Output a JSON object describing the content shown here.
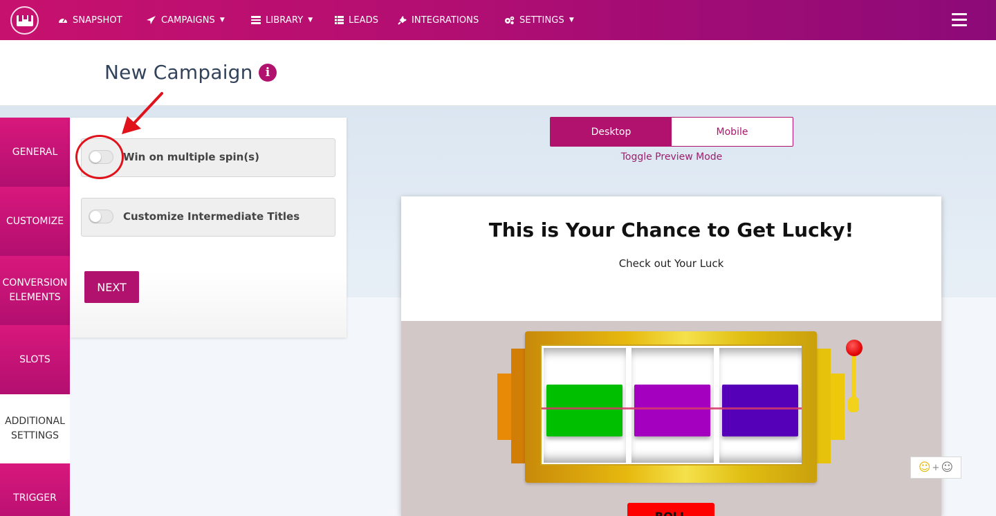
{
  "nav": {
    "items": [
      {
        "label": "SNAPSHOT",
        "icon": "dashboard-icon",
        "caret": false
      },
      {
        "label": "CAMPAIGNS",
        "icon": "paper-plane-icon",
        "caret": true
      },
      {
        "label": "LIBRARY",
        "icon": "library-icon",
        "caret": true
      },
      {
        "label": "LEADS",
        "icon": "list-icon",
        "caret": false
      },
      {
        "label": "INTEGRATIONS",
        "icon": "plug-icon",
        "caret": false
      },
      {
        "label": "SETTINGS",
        "icon": "cogs-icon",
        "caret": true
      }
    ],
    "caret_glyph": "▼",
    "colors": {
      "gradient_start": "#c7116e",
      "gradient_end": "#8c0a78"
    }
  },
  "header": {
    "title": "New Campaign",
    "info_glyph": "i"
  },
  "sidebar": {
    "tabs": [
      {
        "label": "GENERAL",
        "active": false
      },
      {
        "label": "CUSTOMIZE",
        "active": false
      },
      {
        "label": "CONVERSION ELEMENTS",
        "active": false
      },
      {
        "label": "SLOTS",
        "active": false
      },
      {
        "label": "ADDITIONAL SETTINGS",
        "active": true
      },
      {
        "label": "TRIGGER",
        "active": false
      }
    ]
  },
  "form": {
    "options": [
      {
        "label": "Win on multiple spin(s)",
        "enabled": false
      },
      {
        "label": "Customize Intermediate Titles",
        "enabled": false
      }
    ],
    "next_label": "NEXT"
  },
  "preview_mode": {
    "options": [
      "Desktop",
      "Mobile"
    ],
    "selected": "Desktop",
    "caption": "Toggle Preview Mode"
  },
  "preview": {
    "title": "This is Your Chance to Get Lucky!",
    "subtitle": "Check out Your Luck",
    "reels": [
      {
        "color": "#00bf00"
      },
      {
        "color": "#a300c0"
      },
      {
        "color": "#5500b8"
      }
    ],
    "roll_label": "ROLL"
  },
  "accent_color": "#b0126e",
  "annotation_color": "#e0121b"
}
